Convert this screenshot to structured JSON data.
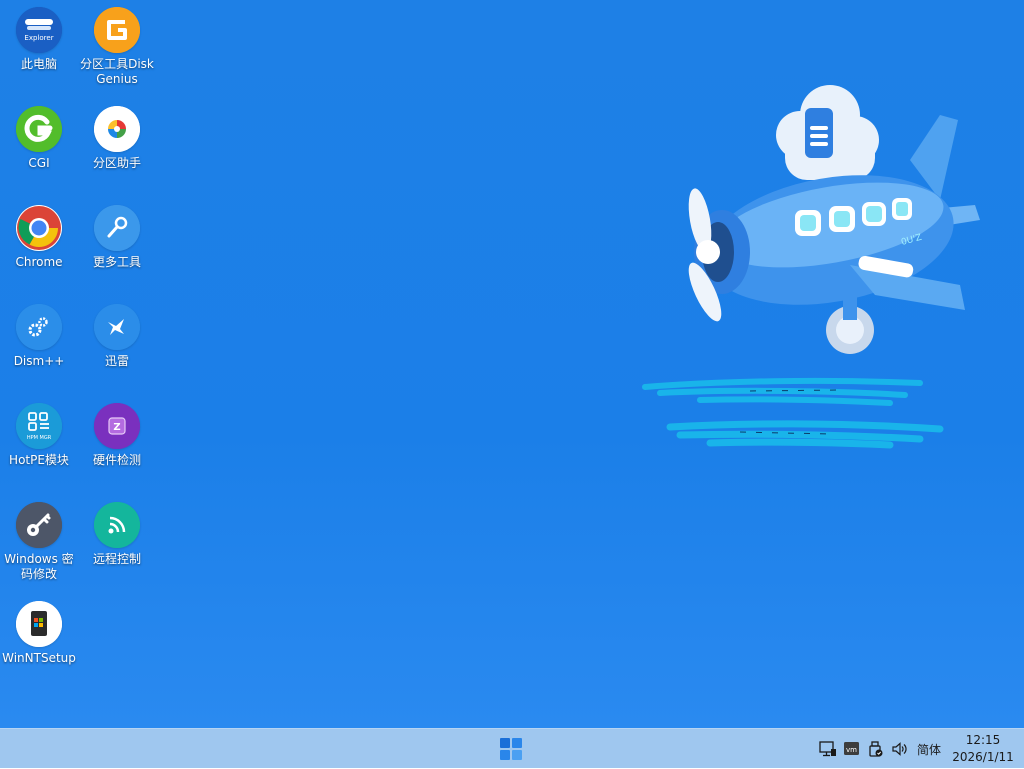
{
  "desktop": {
    "icons": [
      {
        "label": "此电脑",
        "icon": "explorer-icon"
      },
      {
        "label": "分区工具DiskGenius",
        "icon": "diskgenius-icon"
      },
      {
        "label": "CGI",
        "icon": "cgi-icon"
      },
      {
        "label": "分区助手",
        "icon": "partition-assistant-icon"
      },
      {
        "label": "Chrome",
        "icon": "chrome-icon"
      },
      {
        "label": "更多工具",
        "icon": "wrench-icon"
      },
      {
        "label": "Dism++",
        "icon": "gears-icon"
      },
      {
        "label": "迅雷",
        "icon": "thunder-bird-icon"
      },
      {
        "label": "HotPE模块",
        "icon": "hpm-mgr-icon"
      },
      {
        "label": "硬件检测",
        "icon": "chip-icon"
      },
      {
        "label": "Windows 密码修改",
        "icon": "key-icon"
      },
      {
        "label": "远程控制",
        "icon": "remote-control-icon"
      },
      {
        "label": "WinNTSetup",
        "icon": "winntsetup-icon"
      }
    ],
    "explorer_badge_text": "Explorer",
    "hpm_badge_text": "HPM MGR"
  },
  "wallpaper": {
    "plane_badge": "0U'Z"
  },
  "taskbar": {
    "start_icon": "windows-start-icon",
    "tray_icons": [
      "network-icon",
      "vm-icon",
      "usb-safe-remove-icon",
      "volume-icon"
    ],
    "vm_text": "vm",
    "language": "简体",
    "time": "12:15",
    "date": "2026/1/11"
  },
  "colors": {
    "desktop_bg": "#1b7fe8",
    "taskbar_bg": "#9fc7ef"
  }
}
